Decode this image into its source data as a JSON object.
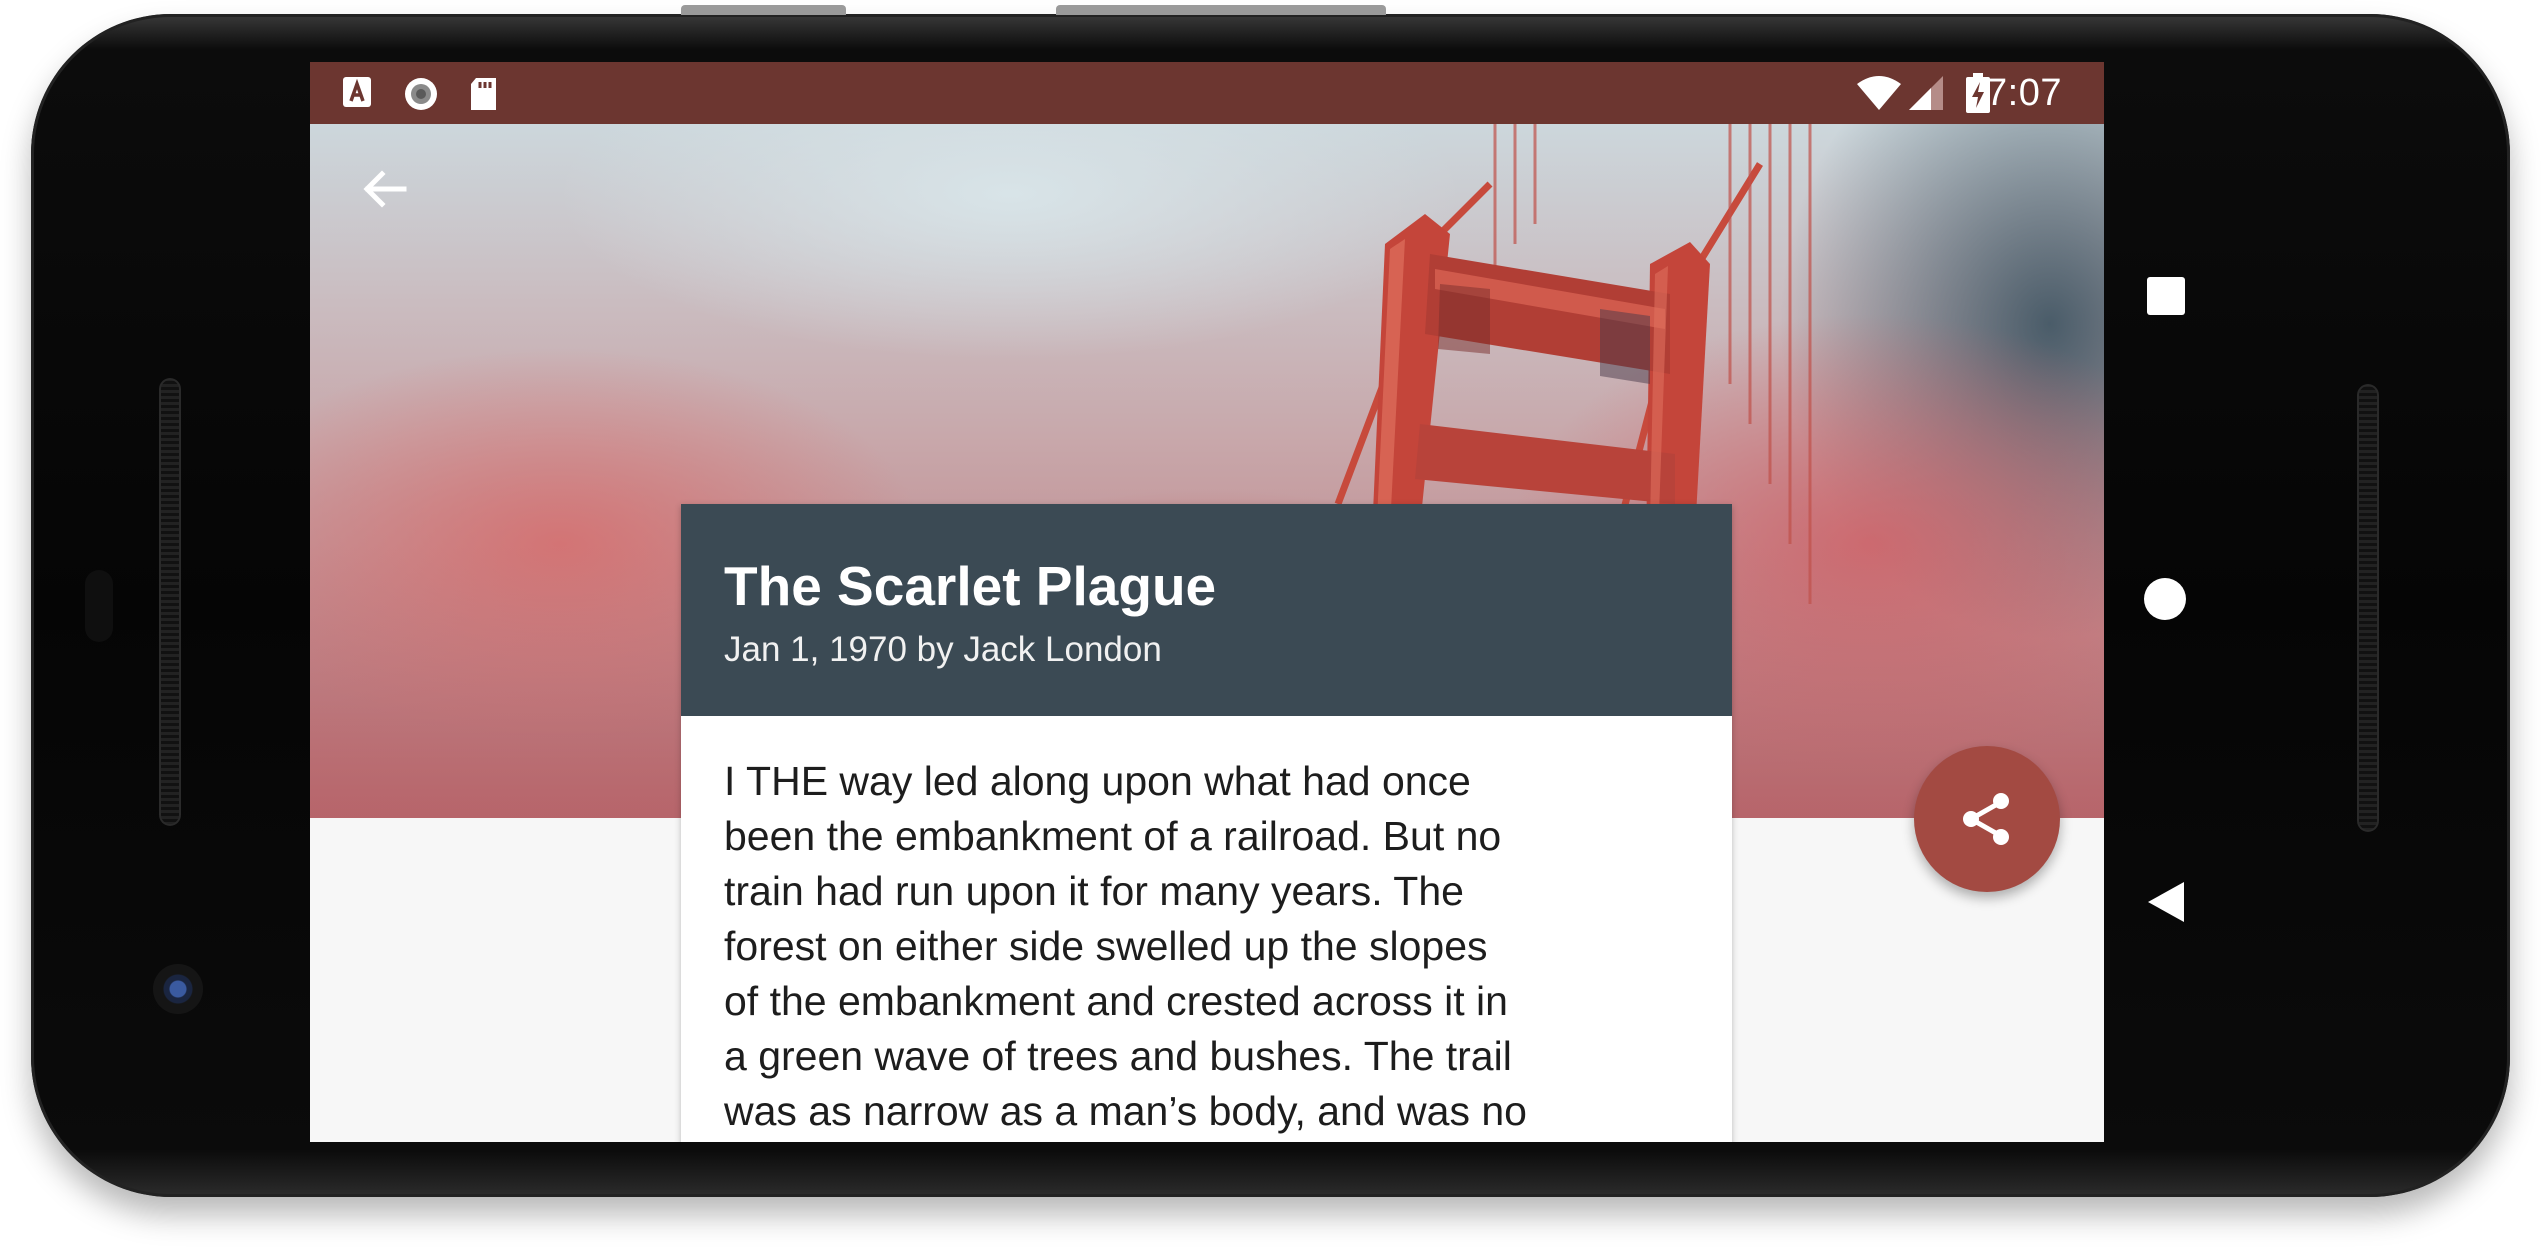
{
  "status_bar": {
    "time": "7:07",
    "background_color": "#6c3630",
    "left_icons": [
      "font-a-icon",
      "radio-circle-icon",
      "sd-card-icon"
    ],
    "right_icons": [
      "wifi-icon",
      "signal-icon",
      "battery-charging-icon"
    ]
  },
  "toolbar": {
    "back_icon": "arrow-back-icon"
  },
  "article": {
    "title": "The Scarlet Plague",
    "subtitle": "Jan 1, 1970 by Jack London",
    "header_color": "#3b4a54",
    "body_lines": [
      "I THE way led along upon what had once",
      "been the embankment of a railroad. But no",
      "train had run upon it for many years. The",
      "forest on either side swelled up the slopes",
      "of the embankment and crested across it in",
      "a green wave of trees and bushes. The trail",
      "was as narrow as a man’s body, and was no"
    ]
  },
  "fab": {
    "icon": "share-icon",
    "color": "#a34a42"
  },
  "navigation_bar": {
    "buttons": [
      "recents-square-icon",
      "home-circle-icon",
      "back-triangle-icon"
    ]
  }
}
